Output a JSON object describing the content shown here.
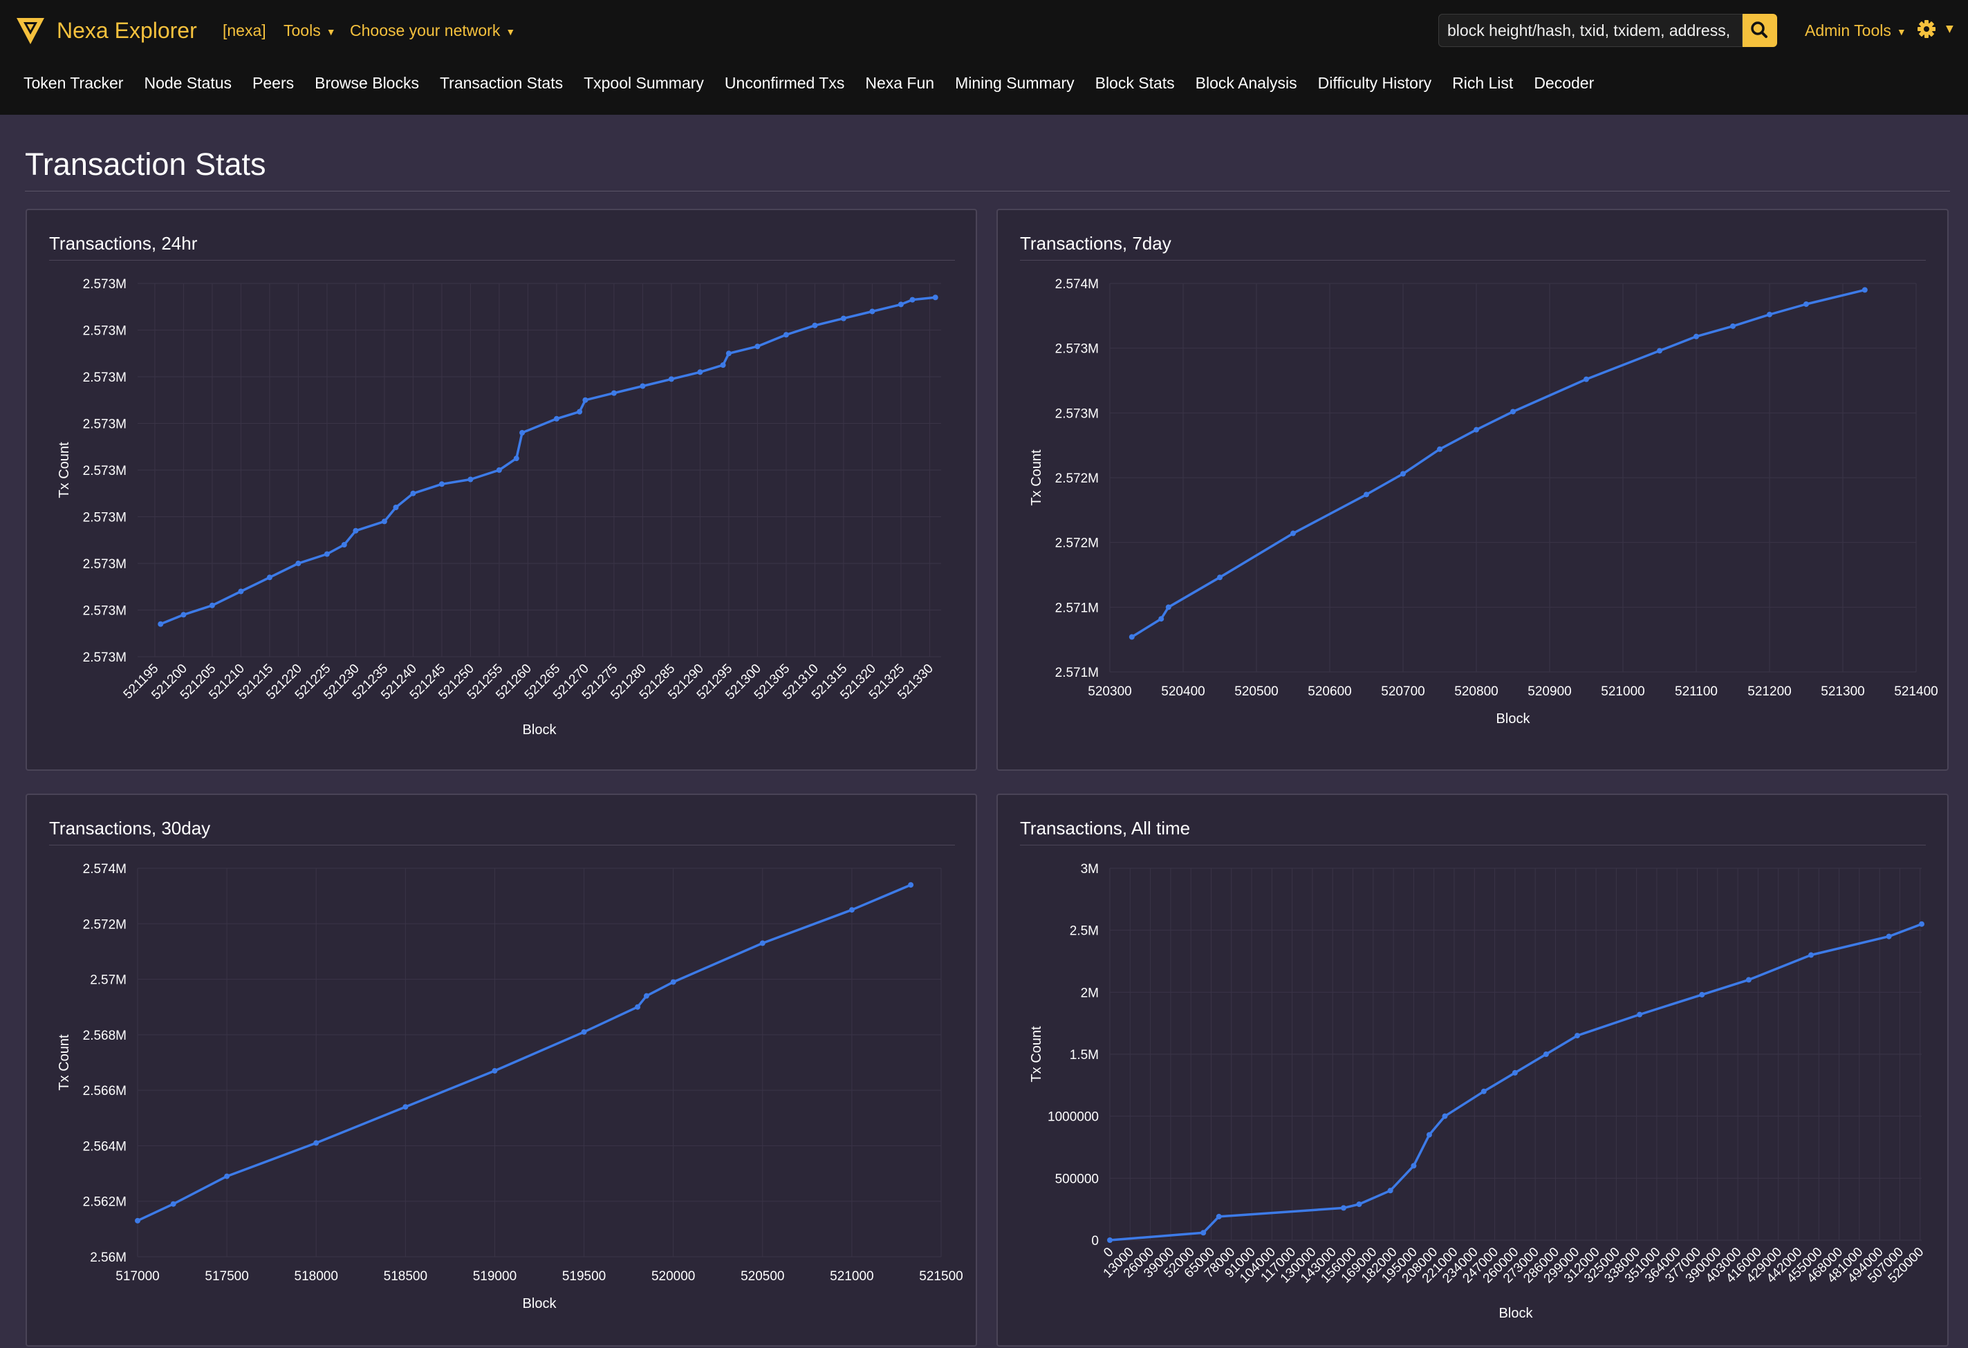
{
  "header": {
    "brand": "Nexa Explorer",
    "network_tag": "[nexa]",
    "tools": "Tools",
    "choose_network": "Choose your network",
    "search_placeholder": "block height/hash, txid, txidem, address, etc",
    "admin_tools": "Admin Tools",
    "colors": {
      "brand": "#f5c13d",
      "bar": "#121212"
    }
  },
  "nav": [
    "Token Tracker",
    "Node Status",
    "Peers",
    "Browse Blocks",
    "Transaction Stats",
    "Txpool Summary",
    "Unconfirmed Txs",
    "Nexa Fun",
    "Mining Summary",
    "Block Stats",
    "Block Analysis",
    "Difficulty History",
    "Rich List",
    "Decoder"
  ],
  "page": {
    "title": "Transaction Stats",
    "background": "#352f44"
  },
  "icons": {
    "logo": "nexa-logo-icon",
    "search": "search-icon",
    "settings": "gear-icon"
  },
  "chart_data": [
    {
      "type": "line",
      "title": "Transactions, 24hr",
      "xlabel": "Block",
      "ylabel": "Tx Count",
      "x_ticks": [
        521195,
        521200,
        521205,
        521210,
        521215,
        521220,
        521225,
        521230,
        521235,
        521240,
        521245,
        521250,
        521255,
        521260,
        521265,
        521270,
        521275,
        521280,
        521285,
        521290,
        521295,
        521300,
        521305,
        521310,
        521315,
        521320,
        521325,
        521330
      ],
      "y_tick_labels": [
        "2.573M",
        "2.573M",
        "2.573M",
        "2.573M",
        "2.573M",
        "2.573M",
        "2.573M",
        "2.573M",
        "2.573M"
      ],
      "xlim": [
        521192,
        521332
      ],
      "ylim": [
        2572550,
        2573350
      ],
      "x": [
        521196,
        521200,
        521205,
        521210,
        521215,
        521220,
        521225,
        521228,
        521230,
        521235,
        521237,
        521240,
        521245,
        521250,
        521255,
        521258,
        521259,
        521265,
        521269,
        521270,
        521275,
        521280,
        521285,
        521290,
        521294,
        521295,
        521300,
        521305,
        521310,
        521315,
        521320,
        521325,
        521327,
        521331
      ],
      "y": [
        2572620,
        2572640,
        2572660,
        2572690,
        2572720,
        2572750,
        2572770,
        2572790,
        2572820,
        2572840,
        2572870,
        2572900,
        2572920,
        2572930,
        2572950,
        2572975,
        2573030,
        2573060,
        2573075,
        2573100,
        2573115,
        2573130,
        2573145,
        2573160,
        2573175,
        2573200,
        2573215,
        2573240,
        2573260,
        2573275,
        2573290,
        2573305,
        2573315,
        2573320
      ],
      "series": [
        {
          "name": "",
          "color": "#3d7be8"
        }
      ],
      "grid": true
    },
    {
      "type": "line",
      "title": "Transactions, 7day",
      "xlabel": "Block",
      "ylabel": "Tx Count",
      "x_ticks": [
        520300,
        520400,
        520500,
        520600,
        520700,
        520800,
        520900,
        521000,
        521100,
        521200,
        521300,
        521400
      ],
      "y_tick_labels": [
        "2.571M",
        "2.571M",
        "2.572M",
        "2.572M",
        "2.573M",
        "2.573M",
        "2.574M"
      ],
      "xlim": [
        520300,
        521400
      ],
      "ylim": [
        2570750,
        2573750
      ],
      "x": [
        520330,
        520370,
        520380,
        520450,
        520550,
        520650,
        520700,
        520750,
        520800,
        520850,
        520950,
        521050,
        521100,
        521150,
        521200,
        521250,
        521330
      ],
      "y": [
        2571020,
        2571160,
        2571250,
        2571480,
        2571820,
        2572120,
        2572280,
        2572470,
        2572620,
        2572760,
        2573010,
        2573230,
        2573340,
        2573420,
        2573510,
        2573590,
        2573700
      ],
      "series": [
        {
          "name": "",
          "color": "#3d7be8"
        }
      ],
      "grid": true
    },
    {
      "type": "line",
      "title": "Transactions, 30day",
      "xlabel": "Block",
      "ylabel": "Tx Count",
      "x_ticks": [
        517000,
        517500,
        518000,
        518500,
        519000,
        519500,
        520000,
        520500,
        521000,
        521500
      ],
      "y_tick_labels": [
        "2.56M",
        "2.562M",
        "2.564M",
        "2.566M",
        "2.568M",
        "2.57M",
        "2.572M",
        "2.574M"
      ],
      "xlim": [
        517000,
        521500
      ],
      "ylim": [
        2560000,
        2574000
      ],
      "x": [
        517000,
        517200,
        517500,
        518000,
        518500,
        519000,
        519500,
        519800,
        519850,
        520000,
        520500,
        521000,
        521330
      ],
      "y": [
        2561300,
        2561900,
        2562900,
        2564100,
        2565400,
        2566700,
        2568100,
        2569000,
        2569400,
        2569900,
        2571300,
        2572500,
        2573400
      ],
      "series": [
        {
          "name": "",
          "color": "#3d7be8"
        }
      ],
      "grid": true
    },
    {
      "type": "line",
      "title": "Transactions, All time",
      "xlabel": "Block",
      "ylabel": "Tx Count",
      "x_ticks": [
        0,
        13000,
        26000,
        39000,
        52000,
        65000,
        78000,
        91000,
        104000,
        117000,
        130000,
        143000,
        156000,
        169000,
        182000,
        195000,
        208000,
        221000,
        234000,
        247000,
        260000,
        273000,
        286000,
        299000,
        312000,
        325000,
        338000,
        351000,
        364000,
        377000,
        390000,
        403000,
        416000,
        429000,
        442000,
        455000,
        468000,
        481000,
        494000,
        507000,
        520000
      ],
      "y_ticks": [
        0,
        500000,
        1000000,
        1500000,
        2000000,
        2500000,
        3000000
      ],
      "y_tick_labels": [
        "0",
        "500000",
        "1000000",
        "1.5M",
        "2M",
        "2.5M",
        "3M"
      ],
      "xlim": [
        0,
        521000
      ],
      "ylim": [
        0,
        3000000
      ],
      "x": [
        0,
        60000,
        70000,
        150000,
        160000,
        180000,
        195000,
        205000,
        215000,
        240000,
        260000,
        280000,
        300000,
        340000,
        380000,
        410000,
        450000,
        500000,
        521000
      ],
      "y": [
        0,
        60000,
        190000,
        260000,
        290000,
        400000,
        600000,
        850000,
        1000000,
        1200000,
        1350000,
        1500000,
        1650000,
        1820000,
        1980000,
        2100000,
        2300000,
        2450000,
        2550000
      ],
      "series": [
        {
          "name": "",
          "color": "#3d7be8"
        }
      ],
      "grid": true
    }
  ]
}
